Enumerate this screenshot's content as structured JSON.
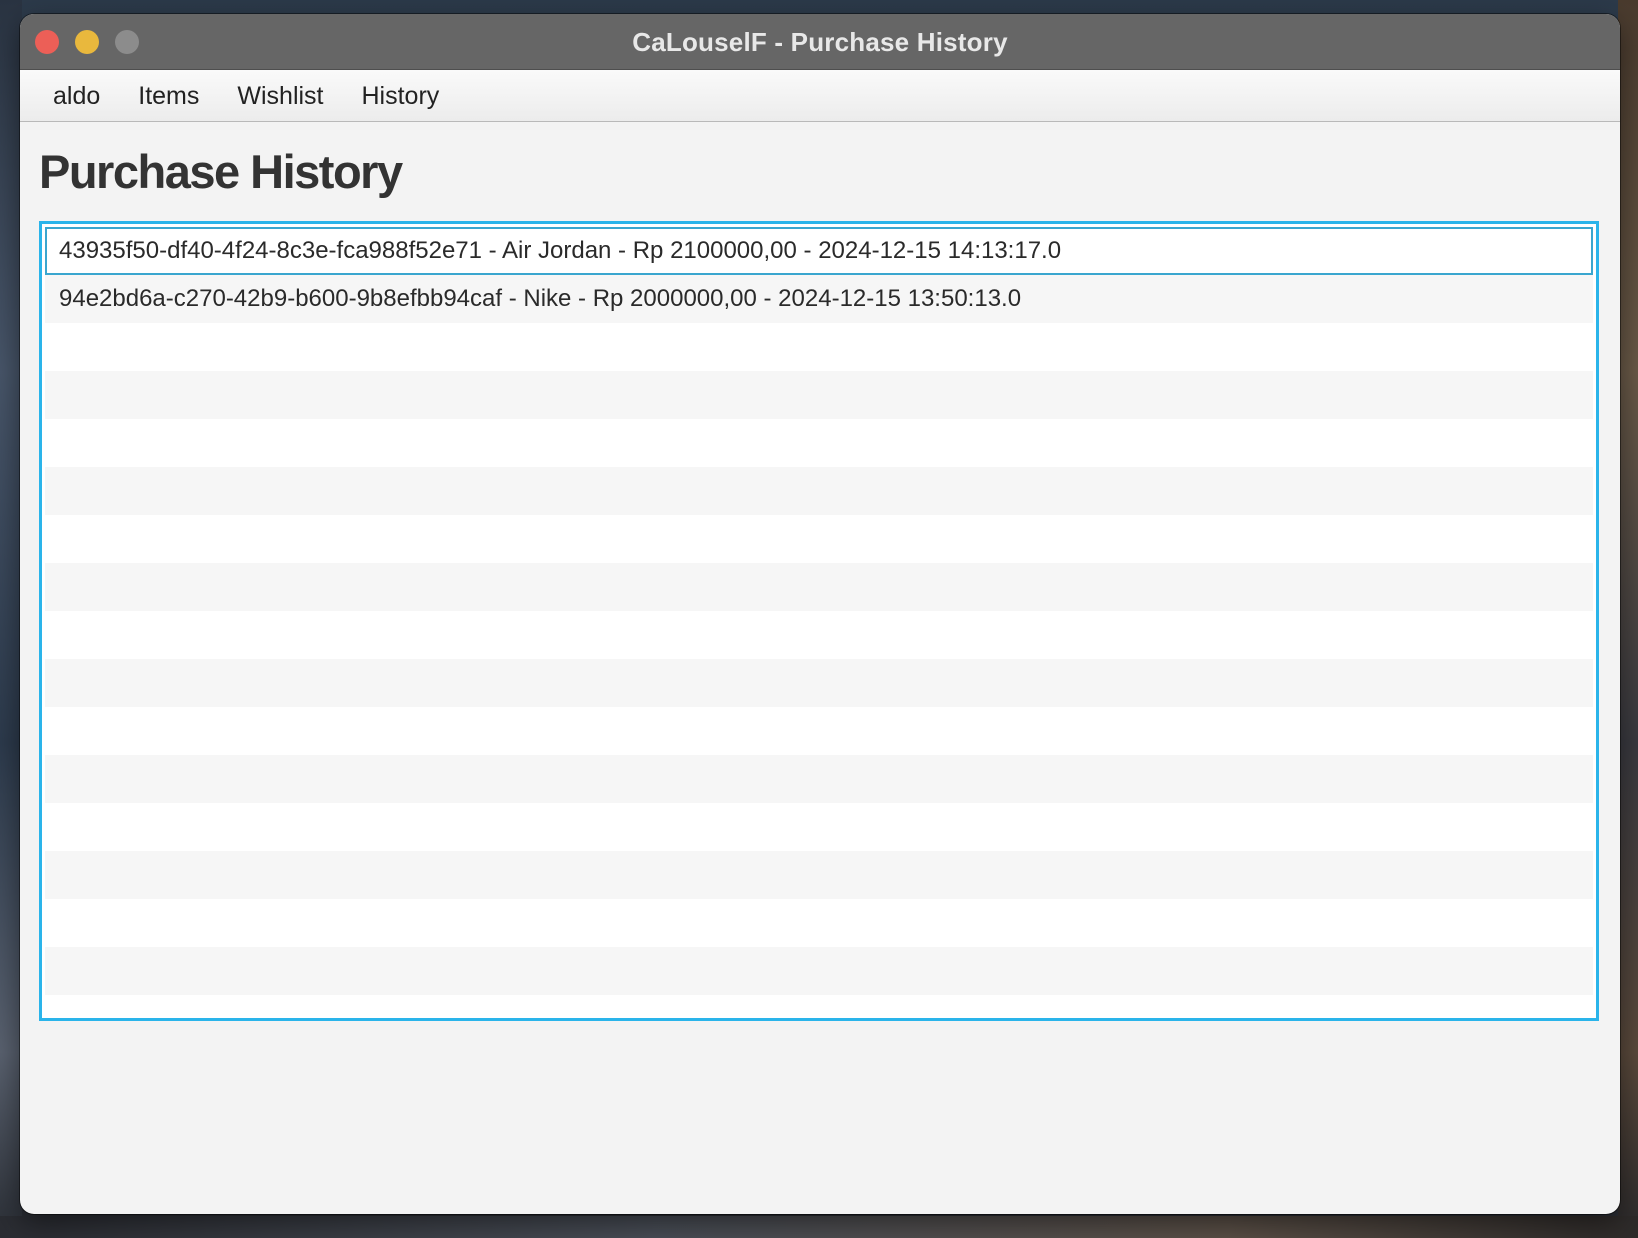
{
  "window": {
    "title": "CaLouselF - Purchase History"
  },
  "menubar": {
    "items": [
      "aldo",
      "Items",
      "Wishlist",
      "History"
    ]
  },
  "page": {
    "heading": "Purchase History"
  },
  "history_list": {
    "items": [
      "43935f50-df40-4f24-8c3e-fca988f52e71 - Air Jordan - Rp 2100000,00 - 2024-12-15 14:13:17.0",
      "94e2bd6a-c270-42b9-b600-9b8efbb94caf - Nike - Rp 2000000,00 - 2024-12-15 13:50:13.0"
    ],
    "selected_index": 0
  },
  "colors": {
    "focus_border": "#2ab4ea",
    "titlebar": "#666666",
    "close": "#ec5f57",
    "minimize": "#e9b83d",
    "maximize": "#8c8c8c"
  }
}
